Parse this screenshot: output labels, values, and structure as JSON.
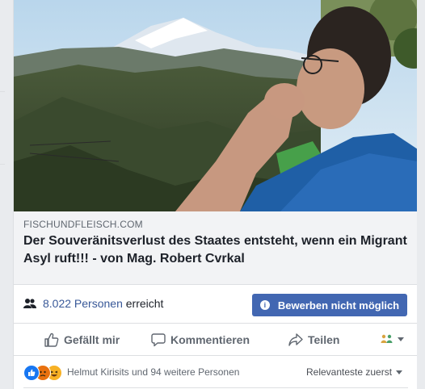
{
  "link": {
    "domain": "FISCHUNDFLEISCH.COM",
    "headline": "Der Souveränitsverlust des Staates entsteht, wenn ein Migrant Asyl ruft!!! - von Mag. Robert Cvrkal"
  },
  "reach": {
    "count_label": "8.022 Personen",
    "suffix": "erreicht",
    "boost_label": "Bewerben nicht möglich"
  },
  "actions": {
    "like_label": "Gefällt mir",
    "comment_label": "Kommentieren",
    "share_label": "Teilen"
  },
  "reactions": {
    "summary": "Helmut Kirisits und 94 weitere Personen",
    "sort_label": "Relevanteste zuerst"
  },
  "colors": {
    "brand_blue": "#4267b2",
    "link_blue": "#385898",
    "like_blue": "#1877f2",
    "angry_red": "#e9710f",
    "haha_yellow": "#f7b125"
  },
  "icons": [
    "people-icon",
    "info-icon",
    "thumbs-up-icon",
    "comment-icon",
    "share-icon",
    "audience-icon",
    "chevron-down-icon",
    "like-reaction-icon",
    "angry-reaction-icon",
    "haha-reaction-icon"
  ]
}
